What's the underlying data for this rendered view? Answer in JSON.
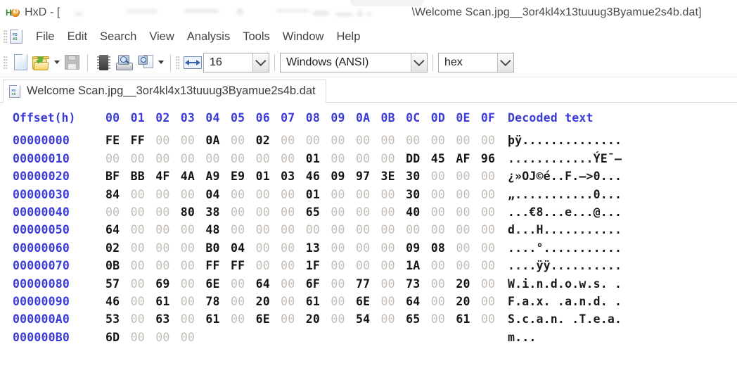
{
  "window": {
    "app_name": "HxD",
    "title_prefix": "HxD - [",
    "title_path_visible": "\\Welcome Scan.jpg__3or4kl4x13tuuug3Byamue2s4b.dat]",
    "app_icon": "hxd-logo-icon"
  },
  "menu": {
    "icon": "document-hex-icon",
    "items": [
      {
        "label": "File"
      },
      {
        "label": "Edit"
      },
      {
        "label": "Search"
      },
      {
        "label": "View"
      },
      {
        "label": "Analysis"
      },
      {
        "label": "Tools"
      },
      {
        "label": "Window"
      },
      {
        "label": "Help"
      }
    ]
  },
  "toolbar": {
    "new_icon": "new-file-icon",
    "open_icon": "open-folder-icon",
    "open_dropdown_icon": "chevron-down-icon",
    "save_icon": "save-disk-icon",
    "ram_icon": "memory-chip-icon",
    "disk_icon": "open-disk-icon",
    "diskimage_icon": "open-disk-image-icon",
    "diskimage_dropdown_icon": "chevron-down-icon",
    "columns_icon": "bytes-per-row-icon",
    "bytes_per_row": "16",
    "encoding": "Windows (ANSI)",
    "offset_base": "hex",
    "dropdown_icon": "chevron-down-icon"
  },
  "tab": {
    "icon": "document-hex-icon",
    "label": "Welcome Scan.jpg__3or4kl4x13tuuug3Byamue2s4b.dat"
  },
  "hexview": {
    "offset_header": "Offset(h)",
    "column_headers": [
      "00",
      "01",
      "02",
      "03",
      "04",
      "05",
      "06",
      "07",
      "08",
      "09",
      "0A",
      "0B",
      "0C",
      "0D",
      "0E",
      "0F"
    ],
    "text_header": "Decoded text",
    "rows": [
      {
        "offset": "00000000",
        "bytes": [
          "FE",
          "FF",
          "00",
          "00",
          "0A",
          "00",
          "02",
          "00",
          "00",
          "00",
          "00",
          "00",
          "00",
          "00",
          "00",
          "00"
        ],
        "text": "þÿ.............."
      },
      {
        "offset": "00000010",
        "bytes": [
          "00",
          "00",
          "00",
          "00",
          "00",
          "00",
          "00",
          "00",
          "01",
          "00",
          "00",
          "00",
          "DD",
          "45",
          "AF",
          "96"
        ],
        "text": "............ÝE¯–"
      },
      {
        "offset": "00000020",
        "bytes": [
          "BF",
          "BB",
          "4F",
          "4A",
          "A9",
          "E9",
          "01",
          "03",
          "46",
          "09",
          "97",
          "3E",
          "30",
          "00",
          "00",
          "00"
        ],
        "text": "¿»OJ©é..F.—>0..."
      },
      {
        "offset": "00000030",
        "bytes": [
          "84",
          "00",
          "00",
          "00",
          "04",
          "00",
          "00",
          "00",
          "01",
          "00",
          "00",
          "00",
          "30",
          "00",
          "00",
          "00"
        ],
        "text": "„...........0..."
      },
      {
        "offset": "00000040",
        "bytes": [
          "00",
          "00",
          "00",
          "80",
          "38",
          "00",
          "00",
          "00",
          "65",
          "00",
          "00",
          "00",
          "40",
          "00",
          "00",
          "00"
        ],
        "text": "...€8...e...@..."
      },
      {
        "offset": "00000050",
        "bytes": [
          "64",
          "00",
          "00",
          "00",
          "48",
          "00",
          "00",
          "00",
          "00",
          "00",
          "00",
          "00",
          "00",
          "00",
          "00",
          "00"
        ],
        "text": "d...H..........."
      },
      {
        "offset": "00000060",
        "bytes": [
          "02",
          "00",
          "00",
          "00",
          "B0",
          "04",
          "00",
          "00",
          "13",
          "00",
          "00",
          "00",
          "09",
          "08",
          "00",
          "00"
        ],
        "text": "....°..........."
      },
      {
        "offset": "00000070",
        "bytes": [
          "0B",
          "00",
          "00",
          "00",
          "FF",
          "FF",
          "00",
          "00",
          "1F",
          "00",
          "00",
          "00",
          "1A",
          "00",
          "00",
          "00"
        ],
        "text": "....ÿÿ.........."
      },
      {
        "offset": "00000080",
        "bytes": [
          "57",
          "00",
          "69",
          "00",
          "6E",
          "00",
          "64",
          "00",
          "6F",
          "00",
          "77",
          "00",
          "73",
          "00",
          "20",
          "00"
        ],
        "text": "W.i.n.d.o.w.s. ."
      },
      {
        "offset": "00000090",
        "bytes": [
          "46",
          "00",
          "61",
          "00",
          "78",
          "00",
          "20",
          "00",
          "61",
          "00",
          "6E",
          "00",
          "64",
          "00",
          "20",
          "00"
        ],
        "text": "F.a.x. .a.n.d. ."
      },
      {
        "offset": "000000A0",
        "bytes": [
          "53",
          "00",
          "63",
          "00",
          "61",
          "00",
          "6E",
          "00",
          "20",
          "00",
          "54",
          "00",
          "65",
          "00",
          "61",
          "00"
        ],
        "text": "S.c.a.n. .T.e.a."
      },
      {
        "offset": "000000B0",
        "bytes": [
          "6D",
          "00",
          "00",
          "00"
        ],
        "text": "m..."
      }
    ]
  },
  "colors": {
    "offset_blue": "#3b3bd6",
    "byte_dark": "#141414",
    "byte_zero_gray": "#c3bdb8",
    "menu_text": "#444444"
  }
}
